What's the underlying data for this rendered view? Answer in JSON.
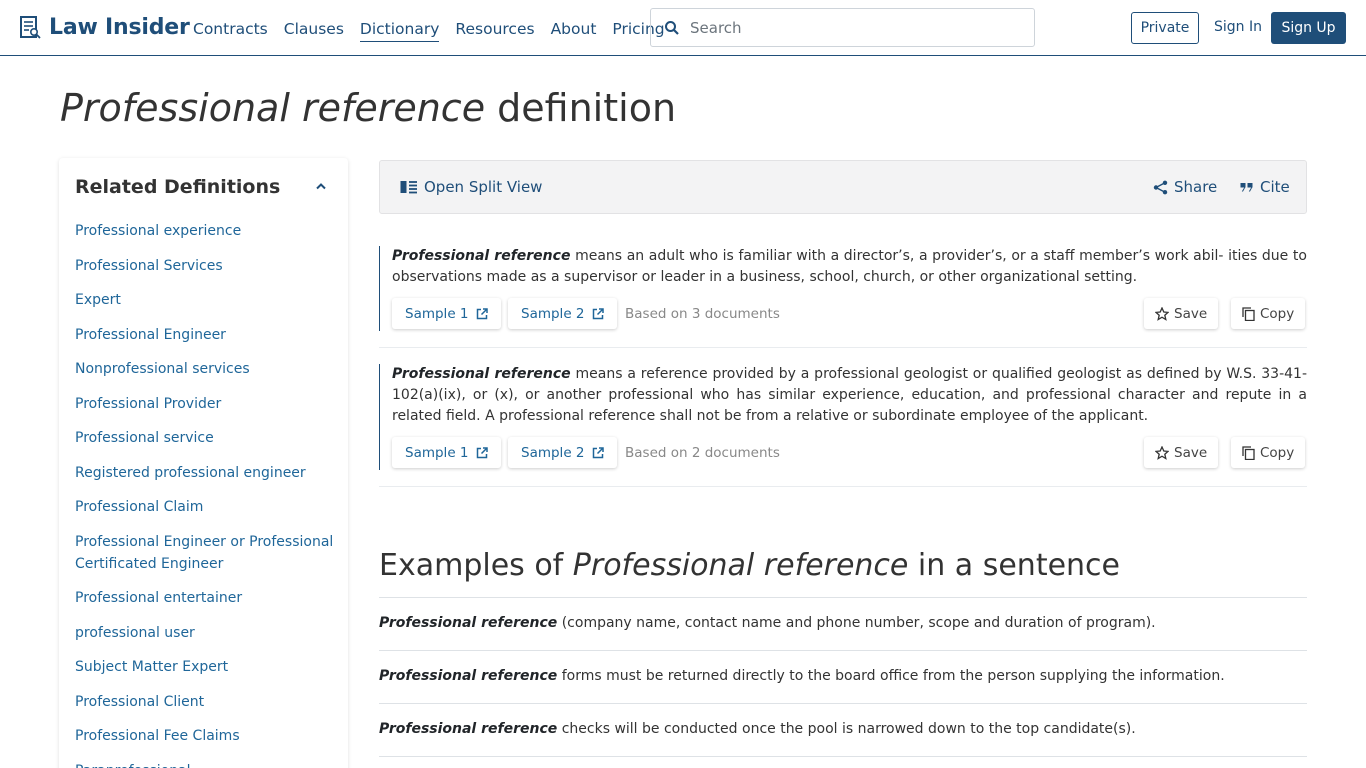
{
  "header": {
    "logo_text": "Law Insider",
    "nav": [
      "Contracts",
      "Clauses",
      "Dictionary",
      "Resources",
      "About",
      "Pricing"
    ],
    "search_placeholder": "Search",
    "private_label": "Private",
    "signin_label": "Sign In",
    "signup_label": "Sign Up"
  },
  "title": {
    "term": "Professional reference",
    "suffix": " definition"
  },
  "sidebar": {
    "title": "Related Definitions",
    "items": [
      "Professional experience",
      "Professional Services",
      "Expert",
      "Professional Engineer",
      "Nonprofessional services",
      "Professional Provider",
      "Professional service",
      "Registered professional engineer",
      "Professional Claim",
      "Professional Engineer or Professional Certificated Engineer",
      "Professional entertainer",
      "professional user",
      "Subject Matter Expert",
      "Professional Client",
      "Professional Fee Claims",
      "Paraprofessional"
    ]
  },
  "toolbar": {
    "split_view": "Open Split View",
    "share": "Share",
    "cite": "Cite"
  },
  "definitions": [
    {
      "term": "Professional reference",
      "text": " means an adult who is familiar with a director’s, a provider’s, or a staff member’s work abil- ities due to observations made as a supervisor or leader in a business, school, church, or other organizational setting.",
      "sample1": "Sample 1",
      "sample2": "Sample 2",
      "based_on": "Based on 3 documents",
      "save": "Save",
      "copy": "Copy"
    },
    {
      "term": "Professional reference",
      "text": " means a reference provided by a professional geologist or qualified geologist as defined by W.S. 33-41-102(a)(ix), or (x), or another professional who has similar experience, education, and professional character and repute in a related field. A professional reference shall not be from a relative or subordinate employee of the applicant.",
      "sample1": "Sample 1",
      "sample2": "Sample 2",
      "based_on": "Based on 2 documents",
      "save": "Save",
      "copy": "Copy"
    }
  ],
  "examples": {
    "prefix": "Examples of ",
    "term": "Professional reference",
    "suffix": " in a sentence",
    "rows": [
      {
        "term": "Professional reference",
        "text": " (company name, contact name and phone number, scope and duration of program)."
      },
      {
        "term": "Professional reference",
        "text": " forms must be returned directly to the board office from the person supplying the information."
      },
      {
        "term": "Professional reference",
        "text": " checks will be conducted once the pool is narrowed down to the top candidate(s)."
      }
    ]
  },
  "colors": {
    "brand": "#1f4e79",
    "link": "#1f6699"
  }
}
